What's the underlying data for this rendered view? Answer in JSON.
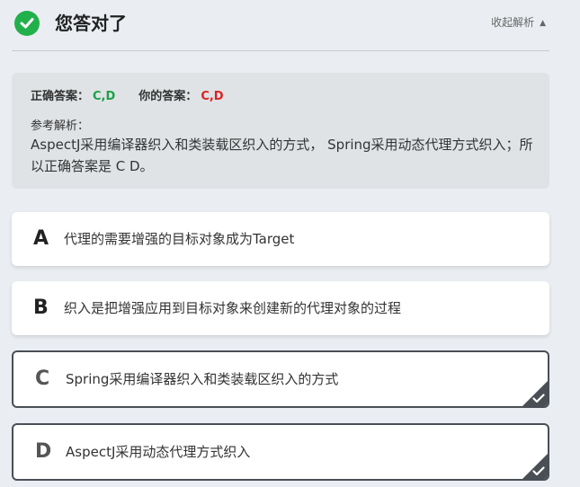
{
  "header": {
    "title": "您答对了",
    "collapse_label": "收起解析",
    "collapse_caret": "▲",
    "success_color": "#22b04b"
  },
  "analysis": {
    "correct_label": "正确答案：",
    "correct_value": "C,D",
    "your_label": "你的答案：",
    "your_value": "C,D",
    "explanation_label": "参考解析：",
    "explanation_text": "AspectJ采用编译器织入和类装载区织入的方式， Spring采用动态代理方式织入；所以正确答案是 C D。",
    "correct_color": "#1fa046",
    "your_color": "#e02020"
  },
  "options": [
    {
      "letter": "A",
      "text": "代理的需要增强的目标对象成为Target",
      "selected": false
    },
    {
      "letter": "B",
      "text": "织入是把增强应用到目标对象来创建新的代理对象的过程",
      "selected": false
    },
    {
      "letter": "C",
      "text": "Spring采用编译器织入和类装载区织入的方式",
      "selected": true
    },
    {
      "letter": "D",
      "text": "AspectJ采用动态代理方式织入",
      "selected": true
    }
  ]
}
